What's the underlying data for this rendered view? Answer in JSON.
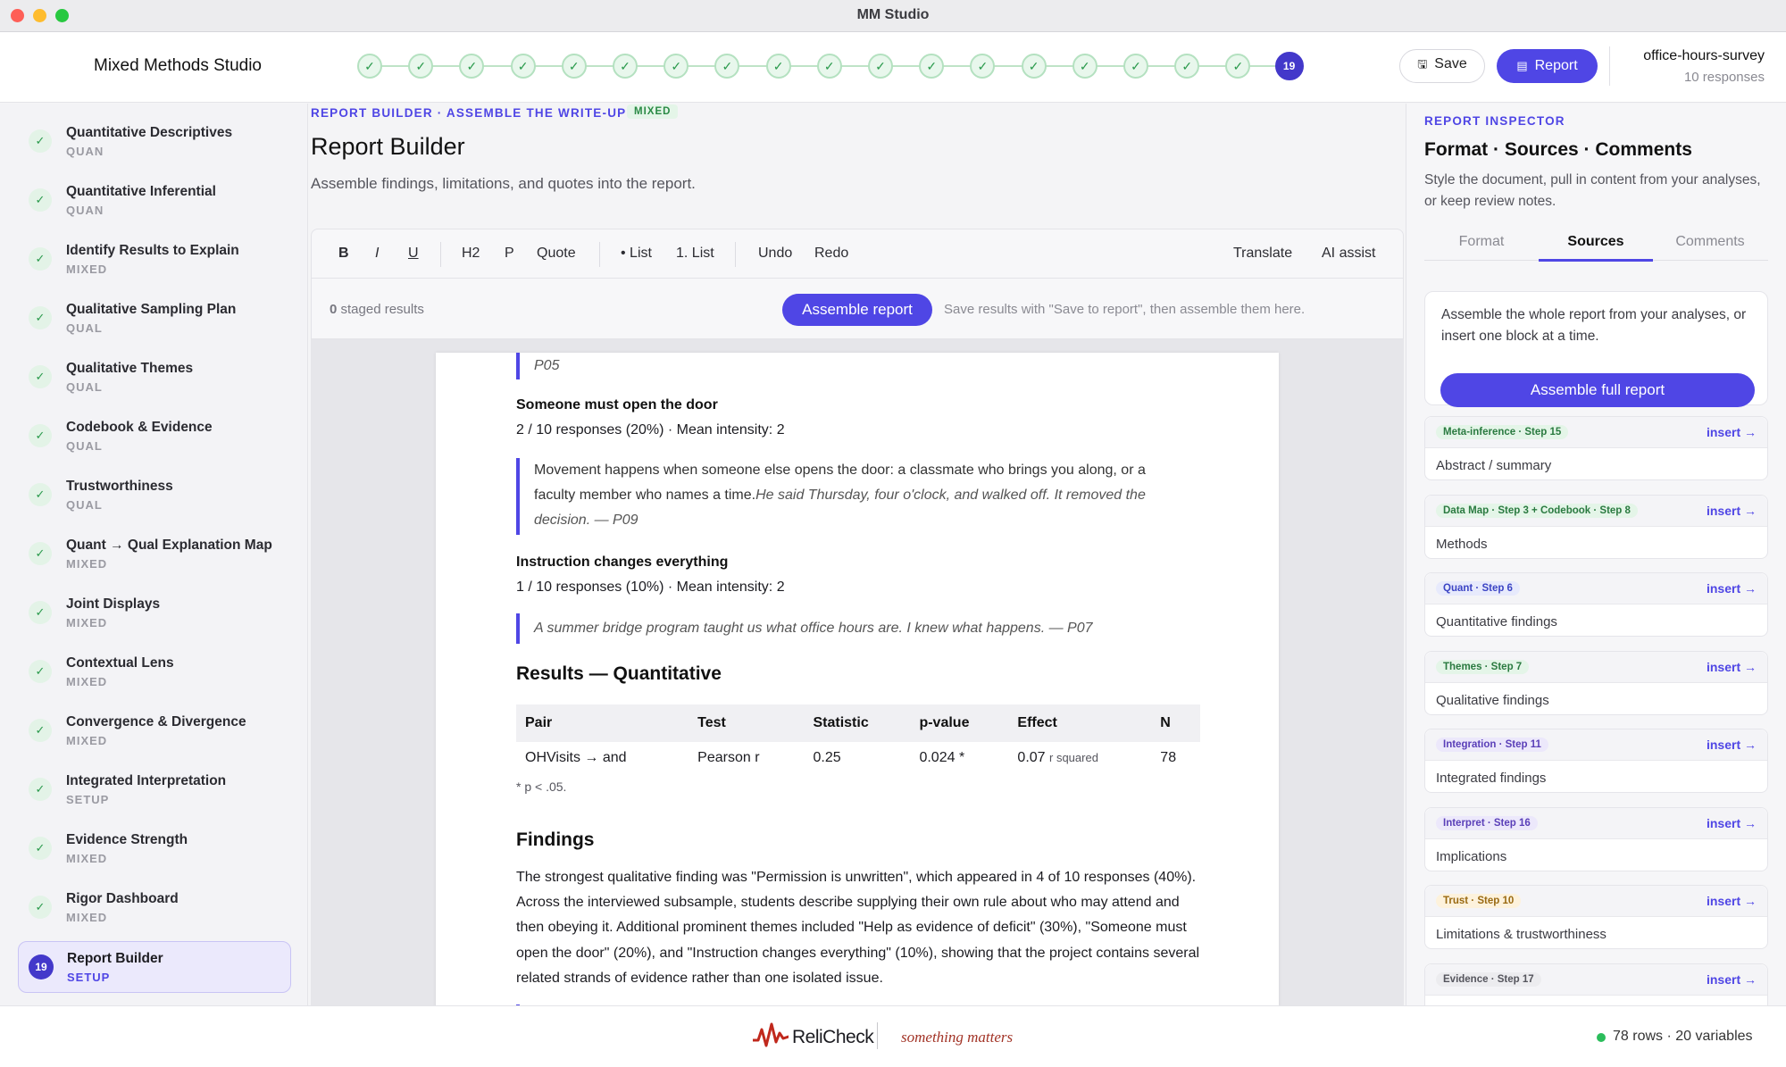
{
  "window": {
    "title": "MM Studio"
  },
  "header": {
    "app_name": "Mixed Methods Studio",
    "steps_completed": 18,
    "current_step": "19",
    "save_label": "Save",
    "report_label": "Report",
    "project_name": "office-hours-survey",
    "project_responses": "10 responses"
  },
  "sidebar": {
    "items": [
      {
        "label": "Quantitative Descriptives",
        "tag": "QUAN",
        "status": "done"
      },
      {
        "label": "Quantitative Inferential",
        "tag": "QUAN",
        "status": "done"
      },
      {
        "label": "Identify Results to Explain",
        "tag": "MIXED",
        "status": "done"
      },
      {
        "label": "Qualitative Sampling Plan",
        "tag": "QUAL",
        "status": "done"
      },
      {
        "label": "Qualitative Themes",
        "tag": "QUAL",
        "status": "done"
      },
      {
        "label": "Codebook & Evidence",
        "tag": "QUAL",
        "status": "done"
      },
      {
        "label": "Trustworthiness",
        "tag": "QUAL",
        "status": "done"
      },
      {
        "label": "Quant → Qual Explanation Map",
        "tag": "MIXED",
        "status": "done"
      },
      {
        "label": "Joint Displays",
        "tag": "MIXED",
        "status": "done"
      },
      {
        "label": "Contextual Lens",
        "tag": "MIXED",
        "status": "done"
      },
      {
        "label": "Convergence & Divergence",
        "tag": "MIXED",
        "status": "done"
      },
      {
        "label": "Integrated Interpretation",
        "tag": "SETUP",
        "status": "done"
      },
      {
        "label": "Evidence Strength",
        "tag": "MIXED",
        "status": "done"
      },
      {
        "label": "Rigor Dashboard",
        "tag": "MIXED",
        "status": "done"
      },
      {
        "label": "Report Builder",
        "tag": "SETUP",
        "status": "current",
        "number": "19"
      }
    ]
  },
  "main": {
    "breadcrumb": "REPORT BUILDER · ASSEMBLE THE WRITE-UP",
    "mode_badge": "MIXED",
    "title": "Report Builder",
    "subtitle": "Assemble findings, limitations, and quotes into the report."
  },
  "toolbar": {
    "bold": "B",
    "italic": "I",
    "underline": "U",
    "h2": "H2",
    "p": "P",
    "quote": "Quote",
    "bullet_list": "• List",
    "numbered_list": "1. List",
    "undo": "Undo",
    "redo": "Redo",
    "translate": "Translate",
    "ai_assist": "AI assist"
  },
  "stagebar": {
    "staged_count": "0",
    "staged_label": "staged results",
    "assemble_label": "Assemble report",
    "hint": "Save results with \"Save to report\", then assemble them here."
  },
  "document": {
    "quote_p05": "P05",
    "theme_door_title": "Someone must open the door",
    "theme_door_stats": "2 / 10 responses (20%) · Mean intensity: 2",
    "theme_door_quote_plain": "Movement happens when someone else opens the door: a classmate who brings you along, or a faculty member who names a time.",
    "theme_door_quote_italic": "He said Thursday, four o'clock, and walked off. It removed the decision. — P09",
    "theme_instr_title": "Instruction changes everything",
    "theme_instr_stats": "1 / 10 responses (10%) · Mean intensity: 2",
    "theme_instr_quote": "A summer bridge program taught us what office hours are. I knew what happens. — P07",
    "results_heading": "Results — Quantitative",
    "table": {
      "headers": [
        "Pair",
        "Test",
        "Statistic",
        "p-value",
        "Effect",
        "N"
      ],
      "row": {
        "pair": "OHVisits → and",
        "test": "Pearson r",
        "statistic": "0.25",
        "p_value": "0.024 *",
        "effect": "0.07",
        "effect_unit": "r squared",
        "n": "78"
      }
    },
    "table_note": "* p < .05.",
    "findings_heading": "Findings",
    "findings_text": "The strongest qualitative finding was \"Permission is unwritten\", which appeared in 4 of 10 responses (40%). Across the interviewed subsample, students describe supplying their own rule about who may attend and then obeying it. Additional prominent themes included \"Help as evidence of deficit\" (30%), \"Someone must open the door\" (20%), and \"Instruction changes everything\" (10%), showing that the project contains several related strands of evidence rather than one isolated issue."
  },
  "inspector": {
    "eyebrow": "REPORT INSPECTOR",
    "title": "Format · Sources · Comments",
    "description": "Style the document, pull in content from your analyses, or keep review notes.",
    "tabs": [
      "Format",
      "Sources",
      "Comments"
    ],
    "active_tab": "Sources",
    "assemble_text": "Assemble the whole report from your analyses, or insert one block at a time.",
    "assemble_full_label": "Assemble full report",
    "insert_label": "insert →",
    "sources": [
      {
        "badge": "Meta-inference · Step 15",
        "label": "Abstract / summary",
        "badge_bg": "#e4f5e8",
        "badge_fg": "#2a7a40"
      },
      {
        "badge": "Data Map · Step 3 + Codebook · Step 8",
        "label": "Methods",
        "badge_bg": "#e4f5e8",
        "badge_fg": "#2a7a40"
      },
      {
        "badge": "Quant · Step 6",
        "label": "Quantitative findings",
        "badge_bg": "#e7eafc",
        "badge_fg": "#3b44c4"
      },
      {
        "badge": "Themes · Step 7",
        "label": "Qualitative findings",
        "badge_bg": "#e4f5e8",
        "badge_fg": "#2a7a40"
      },
      {
        "badge": "Integration · Step 11",
        "label": "Integrated findings",
        "badge_bg": "#ece8fb",
        "badge_fg": "#5a3fb8"
      },
      {
        "badge": "Interpret · Step 16",
        "label": "Implications",
        "badge_bg": "#ece8fb",
        "badge_fg": "#5a3fb8"
      },
      {
        "badge": "Trust · Step 10",
        "label": "Limitations & trustworthiness",
        "badge_bg": "#fdf2dc",
        "badge_fg": "#9a6a12"
      },
      {
        "badge": "Evidence · Step 17",
        "label": "",
        "badge_bg": "#ececef",
        "badge_fg": "#55555d"
      }
    ]
  },
  "footer": {
    "logo_text": "ReliCheck",
    "tagline": "something matters",
    "status": "78 rows · 20 variables"
  }
}
